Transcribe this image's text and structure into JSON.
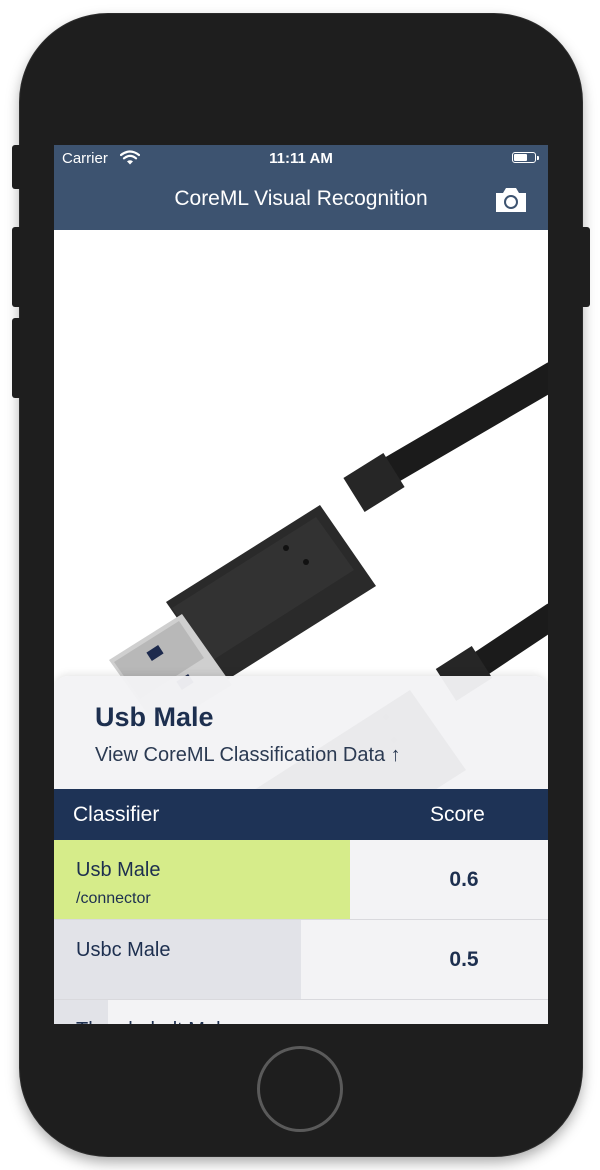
{
  "status_bar": {
    "carrier": "Carrier",
    "time": "11:11 AM",
    "battery_level": 0.6
  },
  "nav": {
    "title": "CoreML Visual Recognition",
    "camera_icon": "camera-icon"
  },
  "photo": {
    "subject_icon": "usb-cable-image"
  },
  "result": {
    "top_label": "Usb Male",
    "link_text": "View CoreML Classification Data ↑"
  },
  "table": {
    "headers": {
      "classifier": "Classifier",
      "score": "Score"
    },
    "rows": [
      {
        "name": "Usb Male",
        "sub": "/connector",
        "score": "0.6",
        "fill": 0.6,
        "color": "#d6ec8a"
      },
      {
        "name": "Usbc Male",
        "sub": "",
        "score": "0.5",
        "fill": 0.5,
        "color": "#e2e3e8"
      },
      {
        "name": "Thunderbolt Male",
        "sub": "",
        "score": "",
        "fill": 0.11,
        "color": "#e2e3e8"
      }
    ]
  },
  "colors": {
    "nav_bar": "#3d5370",
    "table_header": "#1e3356",
    "top_result_fill": "#d6ec8a",
    "text_dark": "#1d2f4f"
  }
}
